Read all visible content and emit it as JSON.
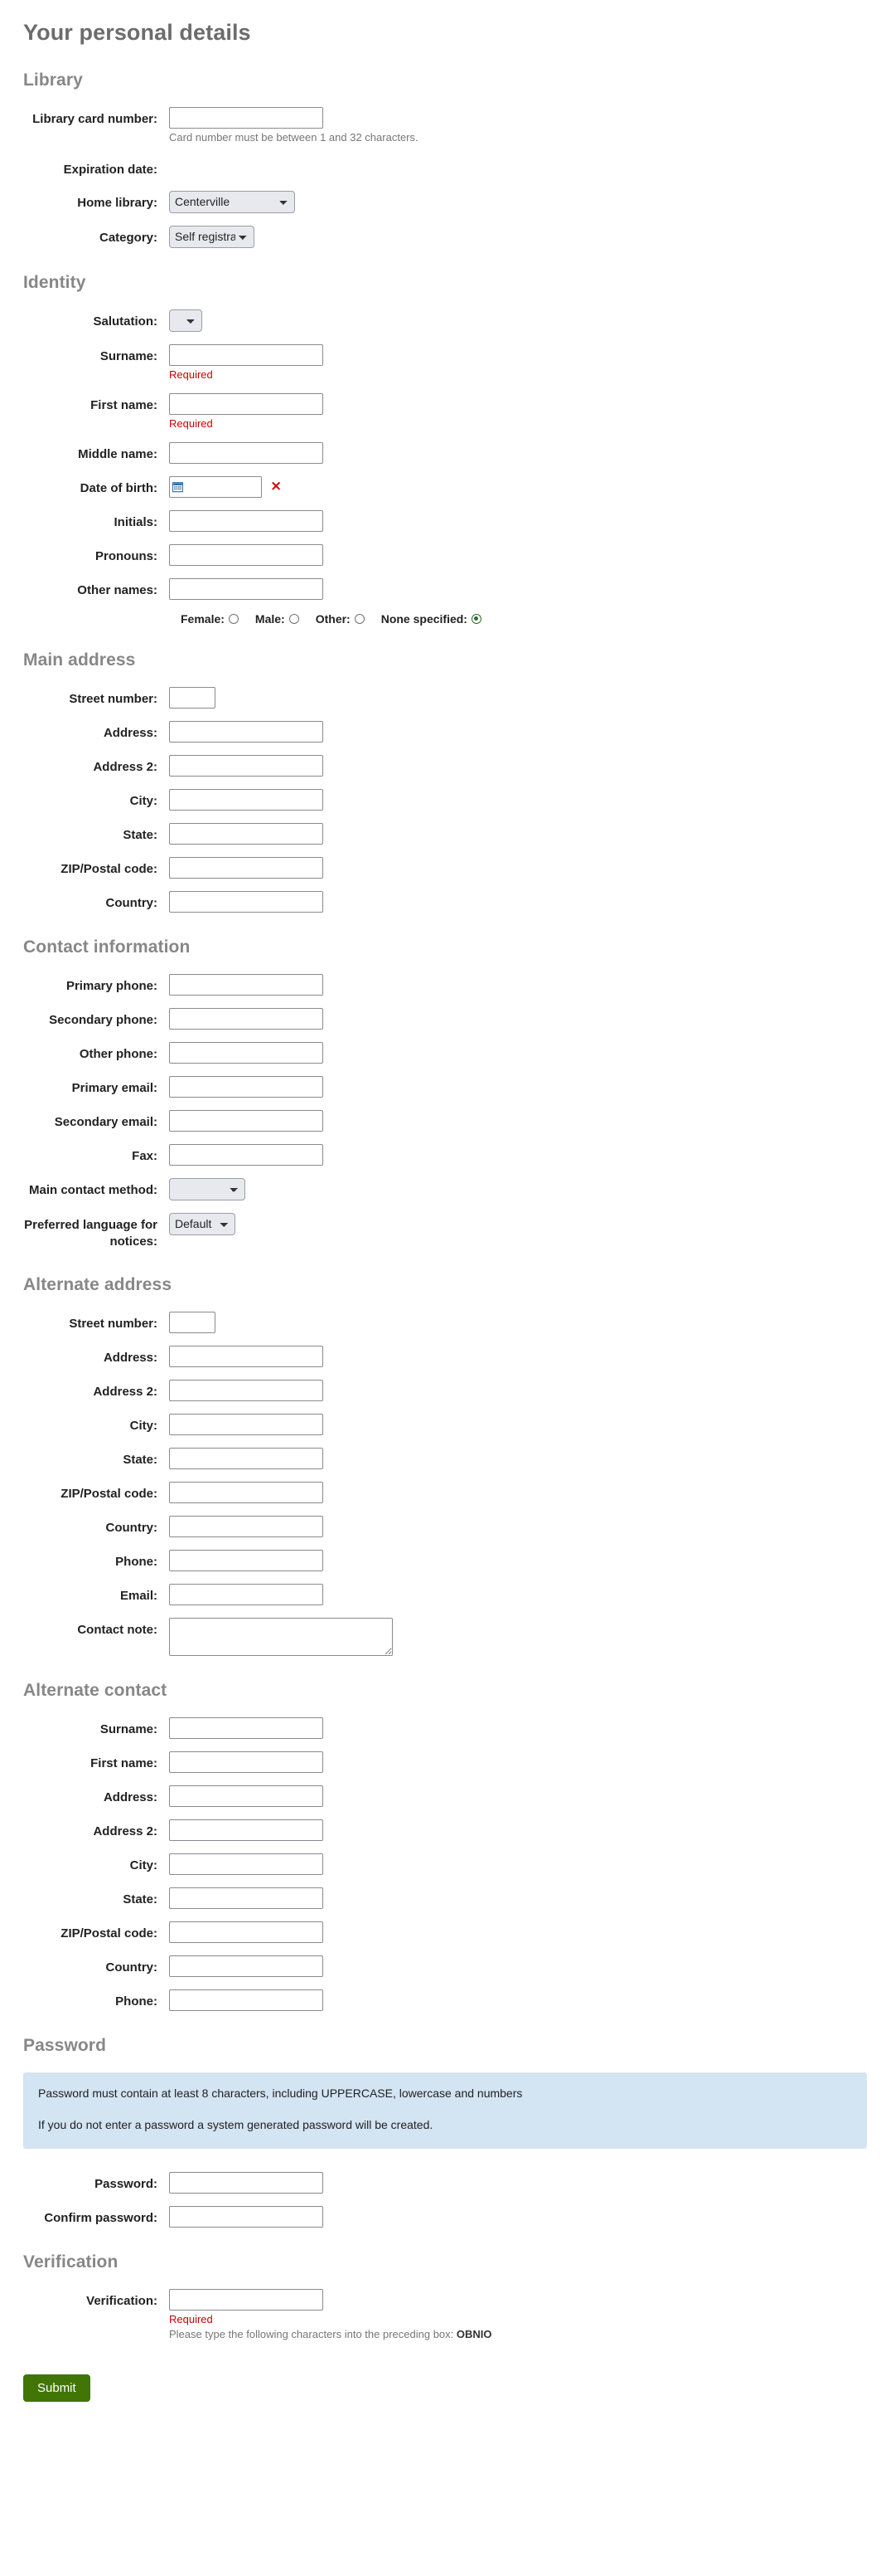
{
  "page": {
    "title": "Your personal details",
    "submit_label": "Submit"
  },
  "sections": {
    "library": {
      "title": "Library",
      "card_number_label": "Library card number:",
      "card_number_hint": "Card number must be between 1 and 32 characters.",
      "card_number_value": "",
      "expiration_label": "Expiration date:",
      "home_library_label": "Home library:",
      "home_library_value": "Centerville",
      "category_label": "Category:",
      "category_value": "Self registration"
    },
    "identity": {
      "title": "Identity",
      "salutation_label": "Salutation:",
      "salutation_value": "",
      "surname_label": "Surname:",
      "surname_required": "Required",
      "first_name_label": "First name:",
      "first_name_required": "Required",
      "middle_name_label": "Middle name:",
      "dob_label": "Date of birth:",
      "dob_value": "",
      "clear_icon": "×",
      "initials_label": "Initials:",
      "pronouns_label": "Pronouns:",
      "other_names_label": "Other names:",
      "gender": {
        "options": [
          {
            "label": "Female:",
            "checked": false
          },
          {
            "label": "Male:",
            "checked": false
          },
          {
            "label": "Other:",
            "checked": false
          },
          {
            "label": "None specified:",
            "checked": true
          }
        ]
      }
    },
    "main_address": {
      "title": "Main address",
      "fields": [
        {
          "label": "Street number:",
          "type": "short"
        },
        {
          "label": "Address:",
          "type": "text"
        },
        {
          "label": "Address 2:",
          "type": "text"
        },
        {
          "label": "City:",
          "type": "text"
        },
        {
          "label": "State:",
          "type": "text"
        },
        {
          "label": "ZIP/Postal code:",
          "type": "text"
        },
        {
          "label": "Country:",
          "type": "text"
        }
      ]
    },
    "contact_information": {
      "title": "Contact information",
      "fields": [
        {
          "label": "Primary phone:",
          "type": "text"
        },
        {
          "label": "Secondary phone:",
          "type": "text"
        },
        {
          "label": "Other phone:",
          "type": "text"
        },
        {
          "label": "Primary email:",
          "type": "text"
        },
        {
          "label": "Secondary email:",
          "type": "text"
        },
        {
          "label": "Fax:",
          "type": "text"
        }
      ],
      "main_contact_label": "Main contact method:",
      "main_contact_value": "",
      "language_label": "Preferred language for notices:",
      "language_value": "Default"
    },
    "alternate_address": {
      "title": "Alternate address",
      "fields": [
        {
          "label": "Street number:",
          "type": "short"
        },
        {
          "label": "Address:",
          "type": "text"
        },
        {
          "label": "Address 2:",
          "type": "text"
        },
        {
          "label": "City:",
          "type": "text"
        },
        {
          "label": "State:",
          "type": "text"
        },
        {
          "label": "ZIP/Postal code:",
          "type": "text"
        },
        {
          "label": "Country:",
          "type": "text"
        },
        {
          "label": "Phone:",
          "type": "text"
        },
        {
          "label": "Email:",
          "type": "text"
        }
      ],
      "contact_note_label": "Contact note:",
      "contact_note_value": ""
    },
    "alternate_contact": {
      "title": "Alternate contact",
      "fields": [
        {
          "label": "Surname:",
          "type": "text"
        },
        {
          "label": "First name:",
          "type": "text"
        },
        {
          "label": "Address:",
          "type": "text"
        },
        {
          "label": "Address 2:",
          "type": "text"
        },
        {
          "label": "City:",
          "type": "text"
        },
        {
          "label": "State:",
          "type": "text"
        },
        {
          "label": "ZIP/Postal code:",
          "type": "text"
        },
        {
          "label": "Country:",
          "type": "text"
        },
        {
          "label": "Phone:",
          "type": "text"
        }
      ]
    },
    "password": {
      "title": "Password",
      "info_line_1": "Password must contain at least 8 characters, including UPPERCASE, lowercase and numbers",
      "info_line_2": "If you do not enter a password a system generated password will be created.",
      "password_label": "Password:",
      "confirm_label": "Confirm password:"
    },
    "verification": {
      "title": "Verification",
      "verification_label": "Verification:",
      "required": "Required",
      "hint_prefix": "Please type the following characters into the preceding box: ",
      "captcha_code": "OBNIO"
    }
  },
  "colors": {
    "accent_green": "#417505",
    "error_red": "#cc0000",
    "info_blue": "#d3e4f3",
    "heading_gray": "#878787"
  }
}
